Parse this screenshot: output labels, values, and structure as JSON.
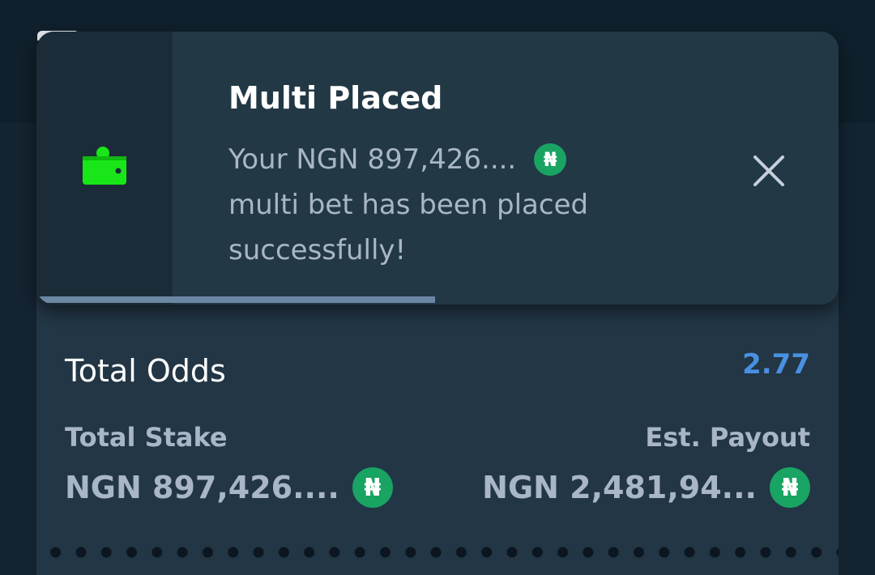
{
  "toast": {
    "title": "Multi Placed",
    "message_line1": "Your NGN 897,426....",
    "message_line2": "multi bet has been placed",
    "message_line3": "successfully!",
    "currency_symbol": "₦",
    "icon": "wallet-icon",
    "close_icon": "close-icon",
    "progress_fraction": 0.497
  },
  "betslip": {
    "total_odds_label": "Total Odds",
    "total_odds_value": "2.77",
    "total_stake_label": "Total Stake",
    "total_stake_value": "NGN 897,426....",
    "est_payout_label": "Est. Payout",
    "est_payout_value": "NGN 2,481,94...",
    "currency_symbol": "₦"
  },
  "colors": {
    "accent_odds": "#4a90e2",
    "currency_badge": "#19a463",
    "wallet_icon": "#19e619"
  }
}
